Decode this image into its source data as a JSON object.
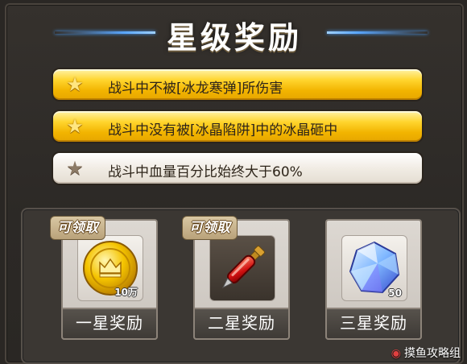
{
  "title": "星级奖励",
  "conditions": [
    {
      "text": "战斗中不被[冰龙寒弹]所伤害",
      "achieved": true
    },
    {
      "text": "战斗中没有被[冰晶陷阱]中的冰晶砸中",
      "achieved": true
    },
    {
      "text": "战斗中血量百分比始终大于60%",
      "achieved": false
    }
  ],
  "rewards": [
    {
      "label": "一星奖励",
      "badge": "可领取",
      "item": "gold-coin-icon",
      "quantity": "10万"
    },
    {
      "label": "二星奖励",
      "badge": "可领取",
      "item": "red-potion-icon",
      "quantity": ""
    },
    {
      "label": "三星奖励",
      "badge": "",
      "item": "blue-crystal-icon",
      "quantity": "50"
    }
  ],
  "watermark": "摸鱼攻略组",
  "colors": {
    "gold": "#f2b400",
    "blue_line": "#5aa7ff",
    "panel": "#2c2926"
  }
}
